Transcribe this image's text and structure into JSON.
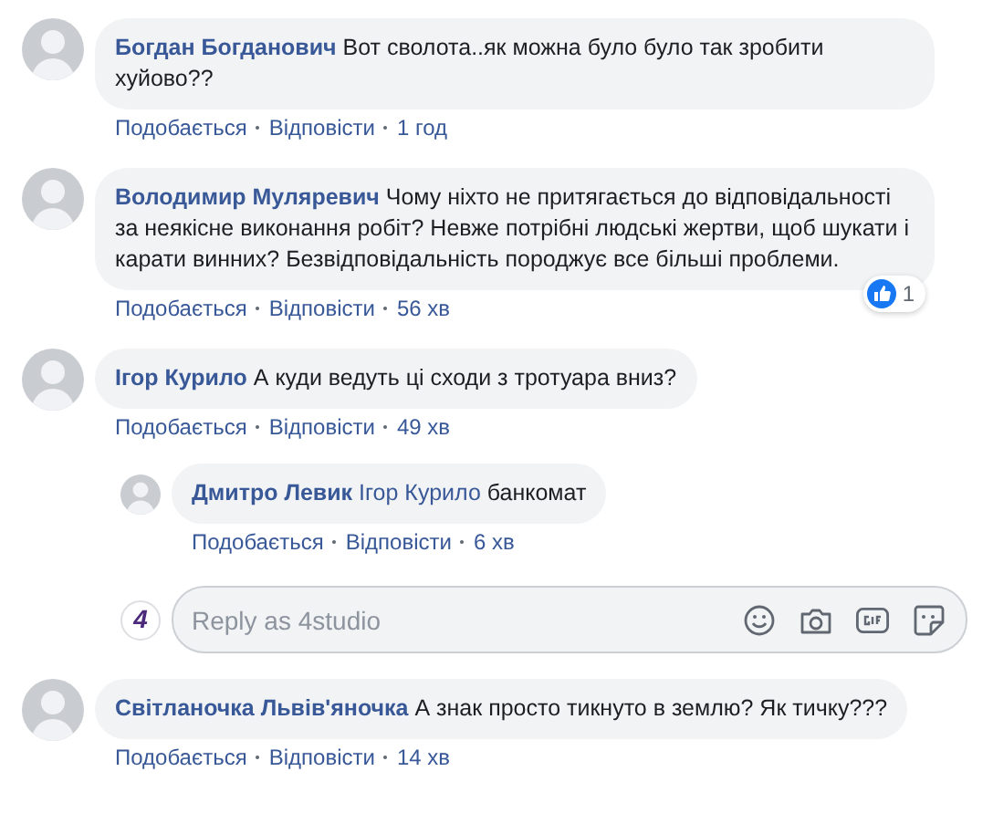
{
  "comments": [
    {
      "author": "Богдан Богданович",
      "text": "Вот сволота..як можна було було так зробити хуйово??",
      "actions": [
        "Подобається",
        "Відповісти"
      ],
      "time": "1 год"
    },
    {
      "author": "Володимир Муляревич",
      "text": "Чому ніхто не притягається до відповідальності за неякісне виконання робіт? Невже потрібні людські жертви, щоб шукати і карати винних? Безвідповідальність породжує все більші проблеми.",
      "actions": [
        "Подобається",
        "Відповісти"
      ],
      "time": "56 хв",
      "reactions": "1"
    },
    {
      "author": "Ігор Курило",
      "text": "А куди ведуть ці сходи з тротуара вниз?",
      "actions": [
        "Подобається",
        "Відповісти"
      ],
      "time": "49 хв",
      "replies": [
        {
          "author": "Дмитро Левик",
          "mention": "Ігор Курило",
          "text": "банкомат",
          "actions": [
            "Подобається",
            "Відповісти"
          ],
          "time": "6 хв"
        }
      ],
      "reply_box": {
        "logo": "4",
        "placeholder": "Reply as 4studio"
      }
    },
    {
      "author": "Світланочка Львів'яночка",
      "text": "А знак просто тикнуто в землю? Як тичку???",
      "actions": [
        "Подобається",
        "Відповісти"
      ],
      "time": "14 хв"
    }
  ]
}
